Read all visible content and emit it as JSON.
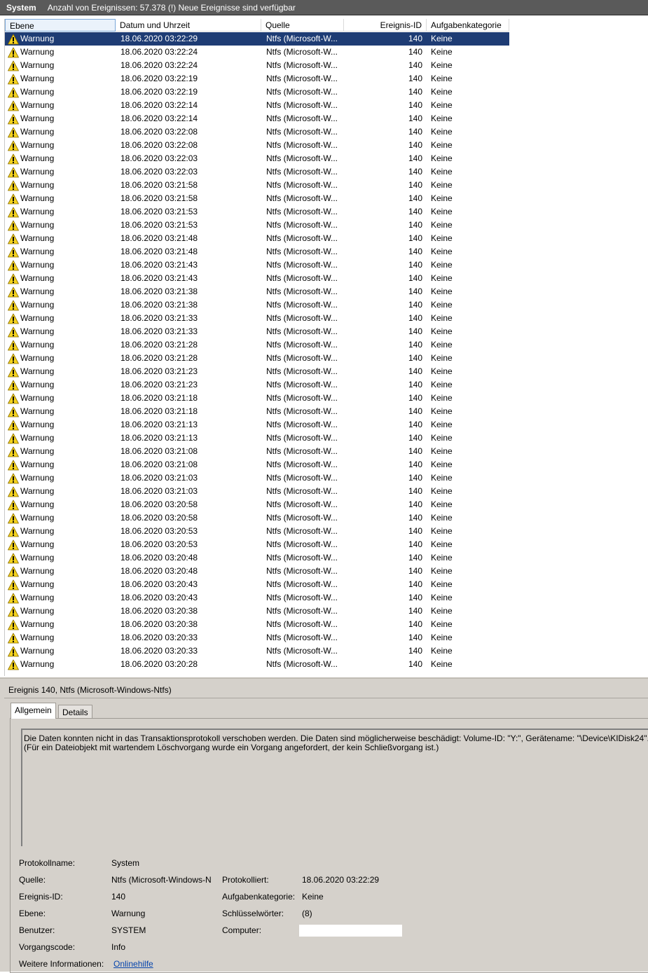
{
  "titlebar": {
    "name": "System",
    "info": "Anzahl von Ereignissen: 57.378 (!) Neue Ereignisse sind verfügbar"
  },
  "columns": {
    "level": "Ebene",
    "date": "Datum und Uhrzeit",
    "source": "Quelle",
    "event_id": "Ereignis-ID",
    "category": "Aufgabenkategorie"
  },
  "row_defaults": {
    "level": "Warnung",
    "source": "Ntfs (Microsoft-W...",
    "event_id": "140",
    "category": "Keine"
  },
  "rows": [
    {
      "date": "18.06.2020 03:22:29"
    },
    {
      "date": "18.06.2020 03:22:24"
    },
    {
      "date": "18.06.2020 03:22:24"
    },
    {
      "date": "18.06.2020 03:22:19"
    },
    {
      "date": "18.06.2020 03:22:19"
    },
    {
      "date": "18.06.2020 03:22:14"
    },
    {
      "date": "18.06.2020 03:22:14"
    },
    {
      "date": "18.06.2020 03:22:08"
    },
    {
      "date": "18.06.2020 03:22:08"
    },
    {
      "date": "18.06.2020 03:22:03"
    },
    {
      "date": "18.06.2020 03:22:03"
    },
    {
      "date": "18.06.2020 03:21:58"
    },
    {
      "date": "18.06.2020 03:21:58"
    },
    {
      "date": "18.06.2020 03:21:53"
    },
    {
      "date": "18.06.2020 03:21:53"
    },
    {
      "date": "18.06.2020 03:21:48"
    },
    {
      "date": "18.06.2020 03:21:48"
    },
    {
      "date": "18.06.2020 03:21:43"
    },
    {
      "date": "18.06.2020 03:21:43"
    },
    {
      "date": "18.06.2020 03:21:38"
    },
    {
      "date": "18.06.2020 03:21:38"
    },
    {
      "date": "18.06.2020 03:21:33"
    },
    {
      "date": "18.06.2020 03:21:33"
    },
    {
      "date": "18.06.2020 03:21:28"
    },
    {
      "date": "18.06.2020 03:21:28"
    },
    {
      "date": "18.06.2020 03:21:23"
    },
    {
      "date": "18.06.2020 03:21:23"
    },
    {
      "date": "18.06.2020 03:21:18"
    },
    {
      "date": "18.06.2020 03:21:18"
    },
    {
      "date": "18.06.2020 03:21:13"
    },
    {
      "date": "18.06.2020 03:21:13"
    },
    {
      "date": "18.06.2020 03:21:08"
    },
    {
      "date": "18.06.2020 03:21:08"
    },
    {
      "date": "18.06.2020 03:21:03"
    },
    {
      "date": "18.06.2020 03:21:03"
    },
    {
      "date": "18.06.2020 03:20:58"
    },
    {
      "date": "18.06.2020 03:20:58"
    },
    {
      "date": "18.06.2020 03:20:53"
    },
    {
      "date": "18.06.2020 03:20:53"
    },
    {
      "date": "18.06.2020 03:20:48"
    },
    {
      "date": "18.06.2020 03:20:48"
    },
    {
      "date": "18.06.2020 03:20:43"
    },
    {
      "date": "18.06.2020 03:20:43"
    },
    {
      "date": "18.06.2020 03:20:38"
    },
    {
      "date": "18.06.2020 03:20:38"
    },
    {
      "date": "18.06.2020 03:20:33"
    },
    {
      "date": "18.06.2020 03:20:33"
    },
    {
      "date": "18.06.2020 03:20:28"
    }
  ],
  "selected_row": 0,
  "detail": {
    "title": "Ereignis 140, Ntfs (Microsoft-Windows-Ntfs)",
    "tabs": {
      "general": "Allgemein",
      "details": "Details"
    },
    "message_line1": "Die Daten konnten nicht in das Transaktionsprotokoll verschoben werden. Die Daten sind möglicherweise beschädigt: Volume-ID: \"Y:\", Gerätename: \"\\Device\\KIDisk24\".",
    "message_line2": "(Für ein Dateiobjekt mit wartendem Löschvorgang wurde ein Vorgang angefordert, der kein Schließvorgang ist.)",
    "labels": {
      "log_name": "Protokollname:",
      "source": "Quelle:",
      "event_id": "Ereignis-ID:",
      "level": "Ebene:",
      "user": "Benutzer:",
      "opcode": "Vorgangscode:",
      "more_info": "Weitere Informationen:",
      "logged": "Protokolliert:",
      "task_category": "Aufgabenkategorie:",
      "keywords": "Schlüsselwörter:",
      "computer": "Computer:"
    },
    "values": {
      "log_name": "System",
      "source": "Ntfs (Microsoft-Windows-N",
      "event_id": "140",
      "level": "Warnung",
      "user": "SYSTEM",
      "opcode": "Info",
      "more_info_link": "Onlinehilfe",
      "logged": "18.06.2020 03:22:29",
      "task_category": "Keine",
      "keywords": "(8)"
    }
  },
  "colors": {
    "selection": "#1e3c74",
    "warning_icon": "#f5d31f",
    "pane_background": "#d5d1cb"
  },
  "icons": {
    "warning": "warning-triangle-icon"
  }
}
